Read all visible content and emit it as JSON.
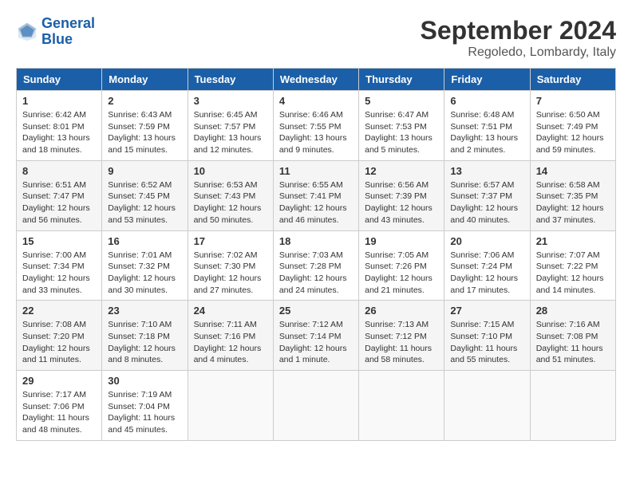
{
  "header": {
    "logo_general": "General",
    "logo_blue": "Blue",
    "month_year": "September 2024",
    "location": "Regoledo, Lombardy, Italy"
  },
  "columns": [
    "Sunday",
    "Monday",
    "Tuesday",
    "Wednesday",
    "Thursday",
    "Friday",
    "Saturday"
  ],
  "weeks": [
    [
      {
        "day": "1",
        "text": "Sunrise: 6:42 AM\nSunset: 8:01 PM\nDaylight: 13 hours and 18 minutes."
      },
      {
        "day": "2",
        "text": "Sunrise: 6:43 AM\nSunset: 7:59 PM\nDaylight: 13 hours and 15 minutes."
      },
      {
        "day": "3",
        "text": "Sunrise: 6:45 AM\nSunset: 7:57 PM\nDaylight: 13 hours and 12 minutes."
      },
      {
        "day": "4",
        "text": "Sunrise: 6:46 AM\nSunset: 7:55 PM\nDaylight: 13 hours and 9 minutes."
      },
      {
        "day": "5",
        "text": "Sunrise: 6:47 AM\nSunset: 7:53 PM\nDaylight: 13 hours and 5 minutes."
      },
      {
        "day": "6",
        "text": "Sunrise: 6:48 AM\nSunset: 7:51 PM\nDaylight: 13 hours and 2 minutes."
      },
      {
        "day": "7",
        "text": "Sunrise: 6:50 AM\nSunset: 7:49 PM\nDaylight: 12 hours and 59 minutes."
      }
    ],
    [
      {
        "day": "8",
        "text": "Sunrise: 6:51 AM\nSunset: 7:47 PM\nDaylight: 12 hours and 56 minutes."
      },
      {
        "day": "9",
        "text": "Sunrise: 6:52 AM\nSunset: 7:45 PM\nDaylight: 12 hours and 53 minutes."
      },
      {
        "day": "10",
        "text": "Sunrise: 6:53 AM\nSunset: 7:43 PM\nDaylight: 12 hours and 50 minutes."
      },
      {
        "day": "11",
        "text": "Sunrise: 6:55 AM\nSunset: 7:41 PM\nDaylight: 12 hours and 46 minutes."
      },
      {
        "day": "12",
        "text": "Sunrise: 6:56 AM\nSunset: 7:39 PM\nDaylight: 12 hours and 43 minutes."
      },
      {
        "day": "13",
        "text": "Sunrise: 6:57 AM\nSunset: 7:37 PM\nDaylight: 12 hours and 40 minutes."
      },
      {
        "day": "14",
        "text": "Sunrise: 6:58 AM\nSunset: 7:35 PM\nDaylight: 12 hours and 37 minutes."
      }
    ],
    [
      {
        "day": "15",
        "text": "Sunrise: 7:00 AM\nSunset: 7:34 PM\nDaylight: 12 hours and 33 minutes."
      },
      {
        "day": "16",
        "text": "Sunrise: 7:01 AM\nSunset: 7:32 PM\nDaylight: 12 hours and 30 minutes."
      },
      {
        "day": "17",
        "text": "Sunrise: 7:02 AM\nSunset: 7:30 PM\nDaylight: 12 hours and 27 minutes."
      },
      {
        "day": "18",
        "text": "Sunrise: 7:03 AM\nSunset: 7:28 PM\nDaylight: 12 hours and 24 minutes."
      },
      {
        "day": "19",
        "text": "Sunrise: 7:05 AM\nSunset: 7:26 PM\nDaylight: 12 hours and 21 minutes."
      },
      {
        "day": "20",
        "text": "Sunrise: 7:06 AM\nSunset: 7:24 PM\nDaylight: 12 hours and 17 minutes."
      },
      {
        "day": "21",
        "text": "Sunrise: 7:07 AM\nSunset: 7:22 PM\nDaylight: 12 hours and 14 minutes."
      }
    ],
    [
      {
        "day": "22",
        "text": "Sunrise: 7:08 AM\nSunset: 7:20 PM\nDaylight: 12 hours and 11 minutes."
      },
      {
        "day": "23",
        "text": "Sunrise: 7:10 AM\nSunset: 7:18 PM\nDaylight: 12 hours and 8 minutes."
      },
      {
        "day": "24",
        "text": "Sunrise: 7:11 AM\nSunset: 7:16 PM\nDaylight: 12 hours and 4 minutes."
      },
      {
        "day": "25",
        "text": "Sunrise: 7:12 AM\nSunset: 7:14 PM\nDaylight: 12 hours and 1 minute."
      },
      {
        "day": "26",
        "text": "Sunrise: 7:13 AM\nSunset: 7:12 PM\nDaylight: 11 hours and 58 minutes."
      },
      {
        "day": "27",
        "text": "Sunrise: 7:15 AM\nSunset: 7:10 PM\nDaylight: 11 hours and 55 minutes."
      },
      {
        "day": "28",
        "text": "Sunrise: 7:16 AM\nSunset: 7:08 PM\nDaylight: 11 hours and 51 minutes."
      }
    ],
    [
      {
        "day": "29",
        "text": "Sunrise: 7:17 AM\nSunset: 7:06 PM\nDaylight: 11 hours and 48 minutes."
      },
      {
        "day": "30",
        "text": "Sunrise: 7:19 AM\nSunset: 7:04 PM\nDaylight: 11 hours and 45 minutes."
      },
      {
        "day": "",
        "text": ""
      },
      {
        "day": "",
        "text": ""
      },
      {
        "day": "",
        "text": ""
      },
      {
        "day": "",
        "text": ""
      },
      {
        "day": "",
        "text": ""
      }
    ]
  ]
}
